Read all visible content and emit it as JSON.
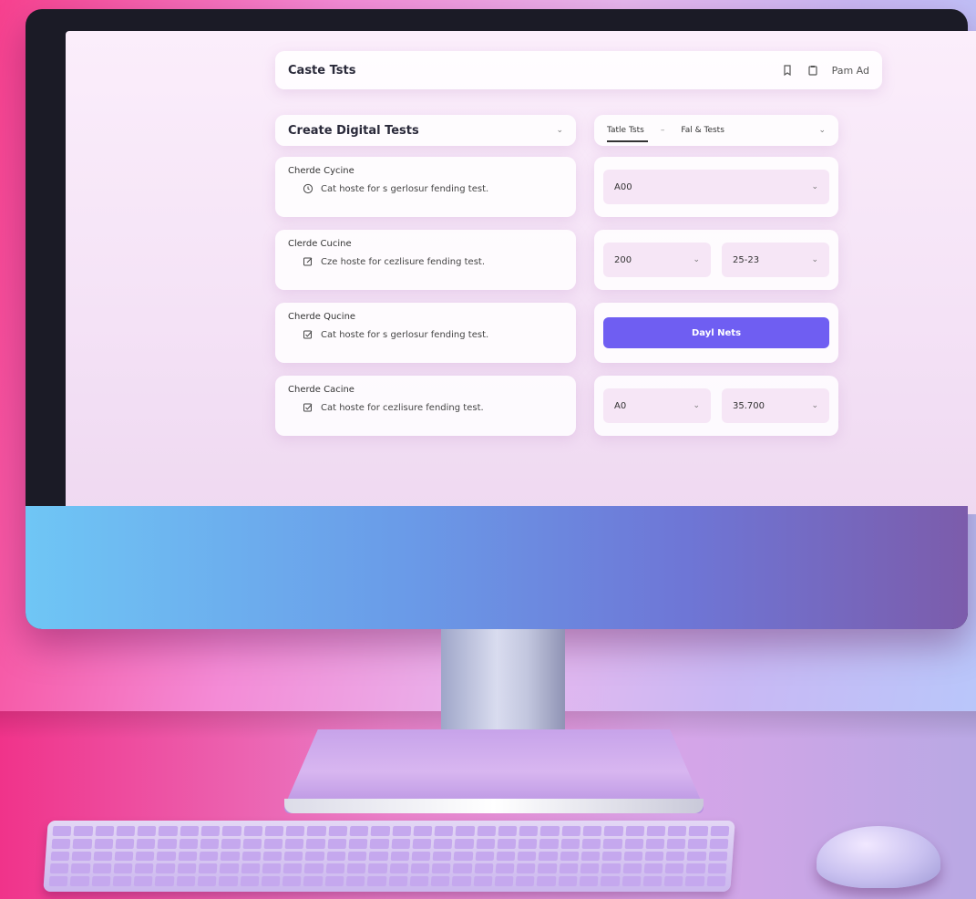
{
  "header": {
    "title": "Caste Tsts",
    "user_label": "Pam Ad"
  },
  "main": {
    "dropdown_title": "Create Digital Tests",
    "tabs": [
      {
        "label": "Tatle Tsts"
      },
      {
        "label": "Fal & Tests"
      }
    ],
    "rows": [
      {
        "title": "Cherde Cycine",
        "desc": "Cat hoste for s gerlosur fending test.",
        "icon": "clock-icon"
      },
      {
        "title": "Clerde Cucine",
        "desc": "Cze hoste for cezlisure fending test.",
        "icon": "edit-icon"
      },
      {
        "title": "Cherde Qucine",
        "desc": "Cat hoste for s gerlosur fending test.",
        "icon": "check-edit-icon"
      },
      {
        "title": "Cherde Cacine",
        "desc": "Cat hoste for cezlisure fending test.",
        "icon": "check-edit-icon"
      }
    ],
    "controls": {
      "row1": {
        "select1": "A00"
      },
      "row2": {
        "select1": "200",
        "select2": "25-23"
      },
      "row3": {
        "button": "Dayl Nets"
      },
      "row4": {
        "select1": "A0",
        "select2": "35.700"
      }
    }
  },
  "colors": {
    "accent": "#6f5ef2",
    "screen_bg": "#f7e6f7"
  }
}
